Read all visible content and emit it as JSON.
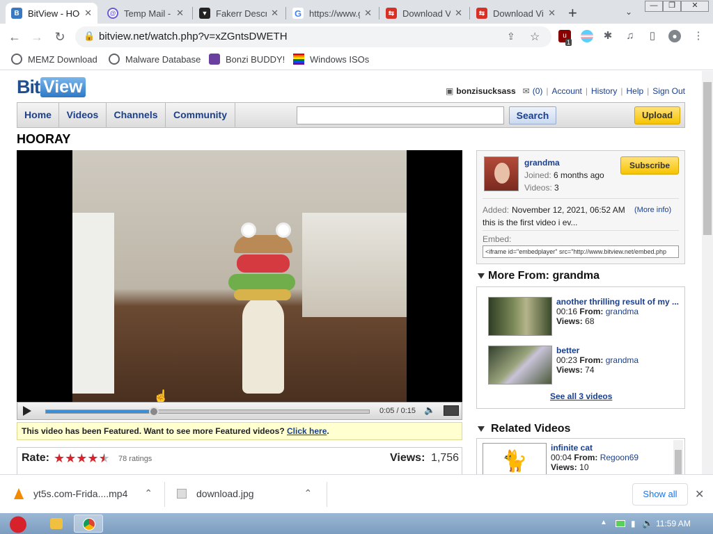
{
  "browser": {
    "tabs": [
      {
        "title": "BitView - HOORAY",
        "active": true
      },
      {
        "title": "Temp Mail - Disposable",
        "active": false
      },
      {
        "title": "Fakerr Description",
        "active": false
      },
      {
        "title": "https://www.google.com",
        "active": false
      },
      {
        "title": "Download Video",
        "active": false
      },
      {
        "title": "Download Video",
        "active": false
      }
    ],
    "url": "bitview.net/watch.php?v=xZGntsDWETH",
    "extension_badge": "1",
    "bookmarks": [
      "MEMZ Download",
      "Malware Database",
      "Bonzi BUDDY!",
      "Windows ISOs"
    ]
  },
  "site": {
    "logo_bit": "Bit",
    "logo_view": "View",
    "username": "bonzisucksass",
    "inbox_count": "(0)",
    "links": [
      "Account",
      "History",
      "Help",
      "Sign Out"
    ],
    "nav": [
      "Home",
      "Videos",
      "Channels",
      "Community"
    ],
    "search_label": "Search",
    "upload_label": "Upload"
  },
  "video": {
    "title": "HOORAY",
    "time": "0:05 / 0:15",
    "progress": 0.333,
    "featured_text": "This video has been Featured. Want to see more Featured videos?",
    "featured_link": "Click here",
    "featured_end": ".",
    "rate_label": "Rate:",
    "rating": 4.5,
    "ratings_count": "78 ratings",
    "views_label": "Views:",
    "views": "1,756"
  },
  "uploader": {
    "name": "grandma",
    "joined_label": "Joined:",
    "joined": "6 months ago",
    "videos_label": "Videos:",
    "videos": "3",
    "subscribe": "Subscribe",
    "added_label": "Added:",
    "added": "November 12, 2021, 06:52 AM",
    "more_info": "(More info)",
    "description": "this is the first video i ev...",
    "embed_label": "Embed:",
    "embed_code": "<iframe id=\"embedplayer\" src=\"http://www.bitview.net/embed.php"
  },
  "more_from": {
    "heading": "More From: grandma",
    "videos": [
      {
        "title": "another thrilling result of my ...",
        "duration": "00:16",
        "from_label": "From:",
        "from": "grandma",
        "views_label": "Views:",
        "views": "68"
      },
      {
        "title": "better",
        "duration": "00:23",
        "from_label": "From:",
        "from": "grandma",
        "views_label": "Views:",
        "views": "74"
      }
    ],
    "see_all": "See all 3 videos"
  },
  "related": {
    "heading": "Related Videos",
    "videos": [
      {
        "title": "infinite cat",
        "duration": "00:04",
        "from_label": "From:",
        "from": "Regoon69",
        "views_label": "Views:",
        "views": "10"
      }
    ]
  },
  "downloads": {
    "items": [
      "yt5s.com-Frida....mp4",
      "download.jpg"
    ],
    "show_all": "Show all"
  },
  "taskbar": {
    "clock": "11:59 AM"
  }
}
